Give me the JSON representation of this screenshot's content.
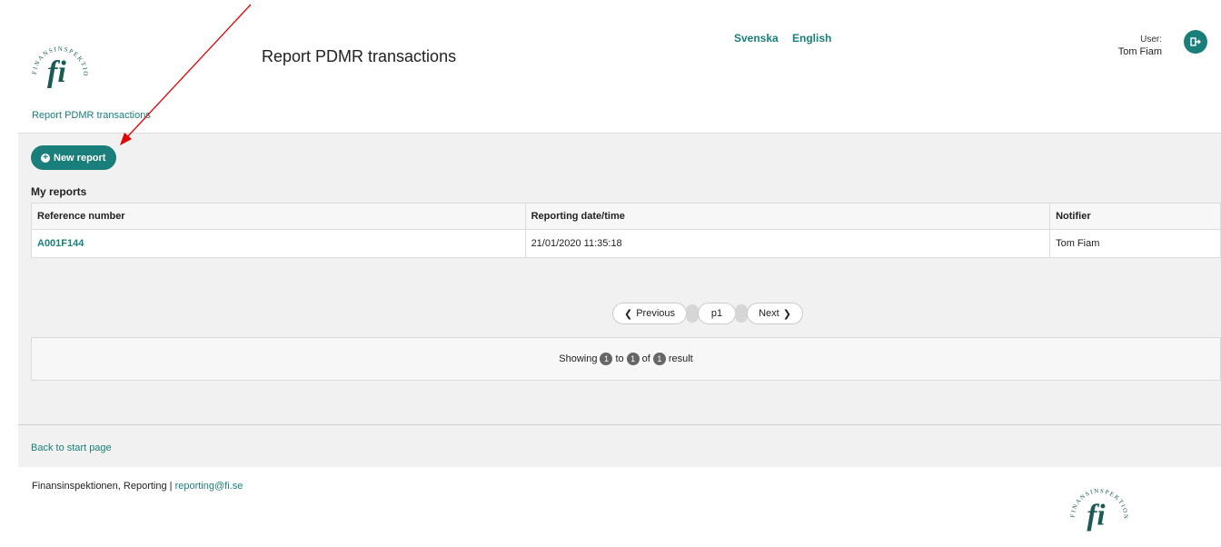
{
  "header": {
    "title": "Report PDMR transactions",
    "lang_svenska": "Svenska",
    "lang_english": "English",
    "user_label": "User:",
    "user_name": "Tom Fiam",
    "logout_icon": "logout-icon",
    "breadcrumb": "Report PDMR transactions",
    "logo_ring_text": "FINANSINSPEKTIONEN",
    "logo_letters": "fi"
  },
  "main": {
    "new_report_label": "New report",
    "section_title": "My reports",
    "table": {
      "columns": [
        "Reference number",
        "Reporting date/time",
        "Notifier"
      ],
      "rows": [
        {
          "reference": "A001F144",
          "date": "21/01/2020 11:35:18",
          "notifier": "Tom Fiam"
        }
      ]
    },
    "pager": {
      "previous": "Previous",
      "page": "p1",
      "next": "Next"
    },
    "result": {
      "showing": "Showing",
      "from": "1",
      "to_word": "to",
      "to": "1",
      "of_word": "of",
      "total": "1",
      "suffix": "result"
    },
    "back_link": "Back to start page"
  },
  "footer": {
    "text": "Finansinspektionen, Reporting | ",
    "email": "reporting@fi.se"
  },
  "colors": {
    "accent": "#1a7f7a",
    "annotation": "#e00000"
  }
}
